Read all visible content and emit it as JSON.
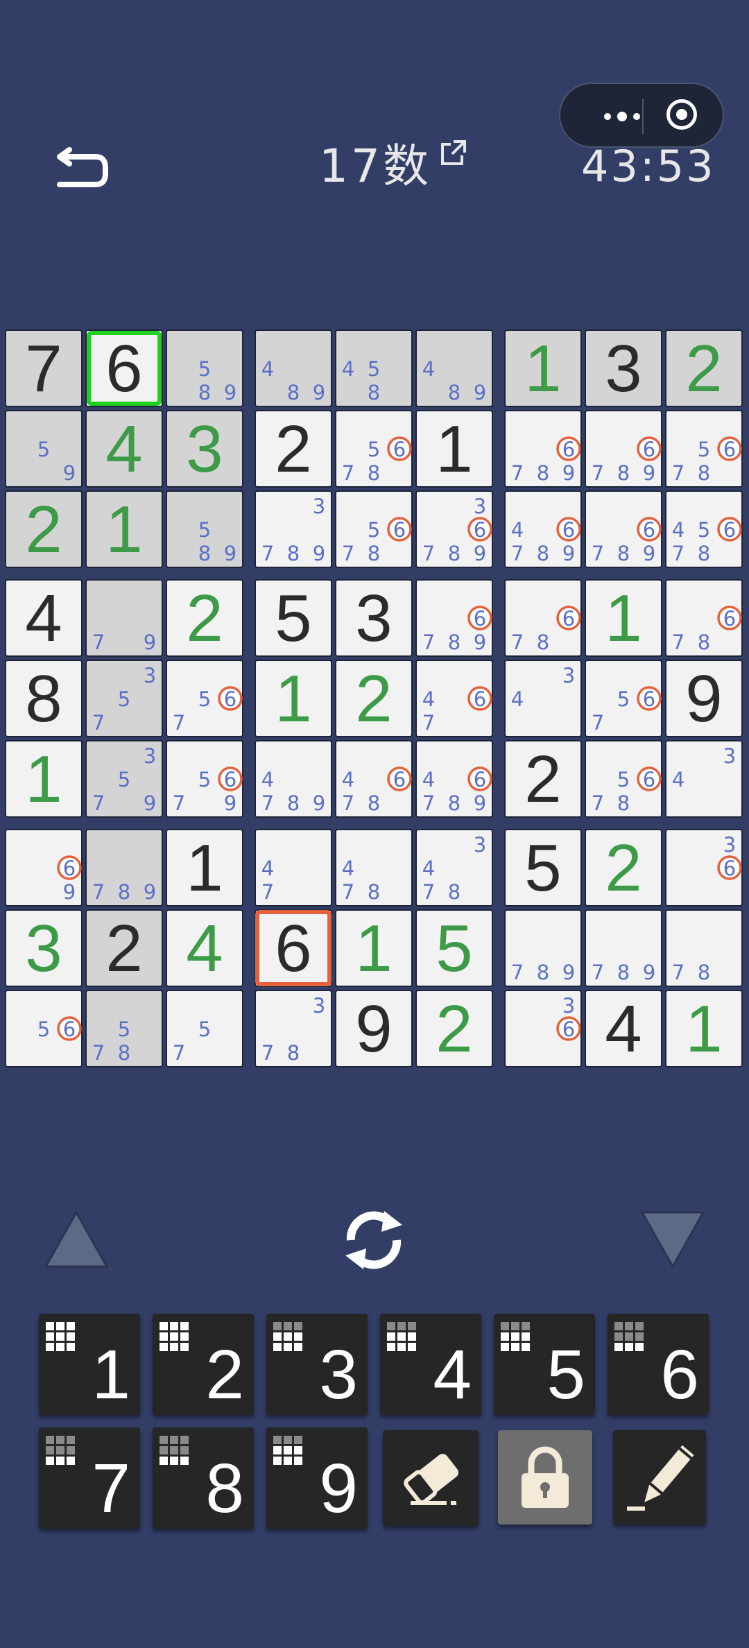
{
  "header": {
    "title": "17数",
    "timer": "43:53"
  },
  "colors": {
    "background": "#323e66",
    "given_digit": "#2b2b2b",
    "user_digit": "#3d9b47",
    "candidate": "#5b6fc6",
    "candidate_highlight_ring": "#e5613b",
    "selected_border": "#1fd11f",
    "conflict_border": "#e5613b",
    "cell_gray": "#d4d4d4",
    "cell_white": "#f2f2f2"
  },
  "board": {
    "rows": [
      [
        {
          "v": "7",
          "t": "given",
          "bg": "gray"
        },
        {
          "v": "6",
          "t": "given",
          "bg": "white",
          "sel": true
        },
        {
          "c": [
            5,
            8,
            9
          ],
          "bg": "gray"
        },
        {
          "c": [
            4,
            8,
            9
          ],
          "bg": "gray"
        },
        {
          "c": [
            4,
            5,
            8
          ],
          "bg": "gray"
        },
        {
          "c": [
            4,
            8,
            9
          ],
          "bg": "gray"
        },
        {
          "v": "1",
          "t": "user",
          "bg": "gray"
        },
        {
          "v": "3",
          "t": "given",
          "bg": "gray"
        },
        {
          "v": "2",
          "t": "user",
          "bg": "gray"
        }
      ],
      [
        {
          "c": [
            5,
            9
          ],
          "bg": "gray"
        },
        {
          "v": "4",
          "t": "user",
          "bg": "gray"
        },
        {
          "v": "3",
          "t": "user",
          "bg": "gray"
        },
        {
          "v": "2",
          "t": "given",
          "bg": "white"
        },
        {
          "c": [
            5,
            6,
            7,
            8
          ],
          "bg": "white"
        },
        {
          "v": "1",
          "t": "given",
          "bg": "white"
        },
        {
          "c": [
            6,
            7,
            8,
            9
          ],
          "bg": "white"
        },
        {
          "c": [
            6,
            7,
            8,
            9
          ],
          "bg": "white"
        },
        {
          "c": [
            5,
            6,
            7,
            8
          ],
          "bg": "white"
        }
      ],
      [
        {
          "v": "2",
          "t": "user",
          "bg": "gray"
        },
        {
          "v": "1",
          "t": "user",
          "bg": "gray"
        },
        {
          "c": [
            5,
            8,
            9
          ],
          "bg": "gray"
        },
        {
          "c": [
            3,
            7,
            8,
            9
          ],
          "bg": "white"
        },
        {
          "c": [
            5,
            6,
            7,
            8
          ],
          "bg": "white"
        },
        {
          "c": [
            3,
            6,
            7,
            8,
            9
          ],
          "bg": "white"
        },
        {
          "c": [
            4,
            6,
            7,
            8,
            9
          ],
          "bg": "white"
        },
        {
          "c": [
            6,
            7,
            8,
            9
          ],
          "bg": "white"
        },
        {
          "c": [
            4,
            5,
            6,
            7,
            8
          ],
          "bg": "white"
        }
      ],
      [
        {
          "v": "4",
          "t": "given",
          "bg": "white"
        },
        {
          "c": [
            7,
            9
          ],
          "bg": "gray"
        },
        {
          "v": "2",
          "t": "user",
          "bg": "white"
        },
        {
          "v": "5",
          "t": "given",
          "bg": "white"
        },
        {
          "v": "3",
          "t": "given",
          "bg": "white"
        },
        {
          "c": [
            6,
            7,
            8,
            9
          ],
          "bg": "white"
        },
        {
          "c": [
            6,
            7,
            8
          ],
          "bg": "white"
        },
        {
          "v": "1",
          "t": "user",
          "bg": "white"
        },
        {
          "c": [
            6,
            7,
            8
          ],
          "bg": "white"
        }
      ],
      [
        {
          "v": "8",
          "t": "given",
          "bg": "white"
        },
        {
          "c": [
            3,
            5,
            7
          ],
          "bg": "gray"
        },
        {
          "c": [
            5,
            6,
            7
          ],
          "bg": "white"
        },
        {
          "v": "1",
          "t": "user",
          "bg": "white"
        },
        {
          "v": "2",
          "t": "user",
          "bg": "white"
        },
        {
          "c": [
            4,
            6,
            7
          ],
          "bg": "white"
        },
        {
          "c": [
            3,
            4
          ],
          "bg": "white"
        },
        {
          "c": [
            5,
            6,
            7
          ],
          "bg": "white"
        },
        {
          "v": "9",
          "t": "given",
          "bg": "white"
        }
      ],
      [
        {
          "v": "1",
          "t": "user",
          "bg": "white"
        },
        {
          "c": [
            3,
            5,
            7,
            9
          ],
          "bg": "gray"
        },
        {
          "c": [
            5,
            6,
            7,
            9
          ],
          "bg": "white"
        },
        {
          "c": [
            4,
            7,
            8,
            9
          ],
          "bg": "white"
        },
        {
          "c": [
            4,
            6,
            7,
            8
          ],
          "bg": "white"
        },
        {
          "c": [
            4,
            6,
            7,
            8,
            9
          ],
          "bg": "white"
        },
        {
          "v": "2",
          "t": "given",
          "bg": "white"
        },
        {
          "c": [
            5,
            6,
            7,
            8
          ],
          "bg": "white"
        },
        {
          "c": [
            3,
            4
          ],
          "bg": "white"
        }
      ],
      [
        {
          "c": [
            6,
            9
          ],
          "bg": "white"
        },
        {
          "c": [
            7,
            8,
            9
          ],
          "bg": "gray"
        },
        {
          "v": "1",
          "t": "given",
          "bg": "white"
        },
        {
          "c": [
            4,
            7
          ],
          "bg": "white"
        },
        {
          "c": [
            4,
            7,
            8
          ],
          "bg": "white"
        },
        {
          "c": [
            3,
            4,
            7,
            8
          ],
          "bg": "white"
        },
        {
          "v": "5",
          "t": "given",
          "bg": "white"
        },
        {
          "v": "2",
          "t": "user",
          "bg": "white"
        },
        {
          "c": [
            3,
            6
          ],
          "bg": "white"
        }
      ],
      [
        {
          "v": "3",
          "t": "user",
          "bg": "white"
        },
        {
          "v": "2",
          "t": "given",
          "bg": "gray"
        },
        {
          "v": "4",
          "t": "user",
          "bg": "white"
        },
        {
          "v": "6",
          "t": "given",
          "bg": "white",
          "conflict": true
        },
        {
          "v": "1",
          "t": "user",
          "bg": "white"
        },
        {
          "v": "5",
          "t": "user",
          "bg": "white"
        },
        {
          "c": [
            7,
            8,
            9
          ],
          "bg": "white"
        },
        {
          "c": [
            7,
            8,
            9
          ],
          "bg": "white"
        },
        {
          "c": [
            7,
            8
          ],
          "bg": "white"
        }
      ],
      [
        {
          "c": [
            5,
            6
          ],
          "bg": "white"
        },
        {
          "c": [
            5,
            7,
            8
          ],
          "bg": "gray"
        },
        {
          "c": [
            5,
            7
          ],
          "bg": "white"
        },
        {
          "c": [
            3,
            7,
            8
          ],
          "bg": "white"
        },
        {
          "v": "9",
          "t": "given",
          "bg": "white"
        },
        {
          "v": "2",
          "t": "user",
          "bg": "white"
        },
        {
          "c": [
            3,
            6
          ],
          "bg": "white"
        },
        {
          "v": "4",
          "t": "given",
          "bg": "white"
        },
        {
          "v": "1",
          "t": "user",
          "bg": "white"
        }
      ]
    ],
    "highlight_candidate": 6
  },
  "controls": {
    "prev_icon": "triangle-up-icon",
    "refresh_icon": "refresh-icon",
    "next_icon": "triangle-down-icon"
  },
  "keypad": {
    "digits": [
      {
        "label": "1",
        "remaining": 0
      },
      {
        "label": "2",
        "remaining": 0
      },
      {
        "label": "3",
        "remaining": 3
      },
      {
        "label": "4",
        "remaining": 3
      },
      {
        "label": "5",
        "remaining": 3
      },
      {
        "label": "6",
        "remaining": 6
      },
      {
        "label": "7",
        "remaining": 6
      },
      {
        "label": "8",
        "remaining": 6
      },
      {
        "label": "9",
        "remaining": 3
      }
    ],
    "tools": [
      "eraser-icon",
      "lock-icon",
      "pencil-icon"
    ]
  }
}
